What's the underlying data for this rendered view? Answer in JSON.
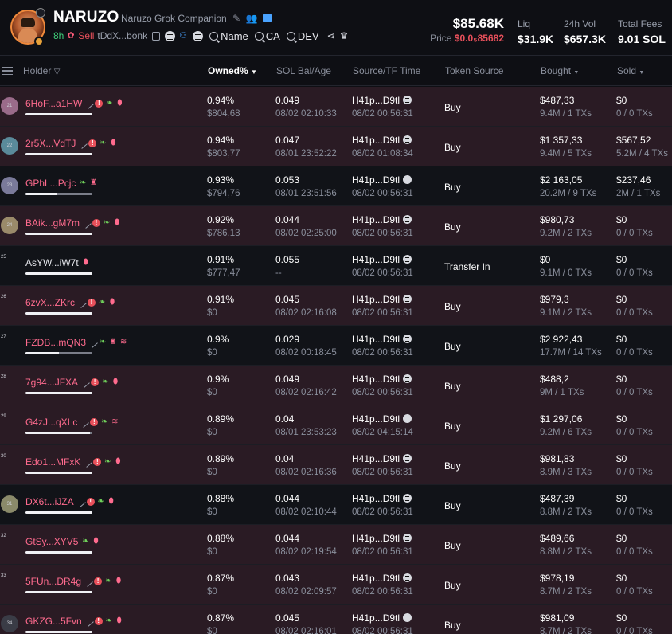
{
  "header": {
    "token_name": "NARUZO",
    "token_fullname": "Naruzo Grok Companion",
    "age": "8h",
    "sell_label": "Sell",
    "address": "tDdX...bonk",
    "search_name": "Name",
    "search_ca": "CA",
    "search_dev": "DEV",
    "mcap": "$85.68K",
    "price_label": "Price",
    "price_value": "$0.0₅85682",
    "liq_label": "Liq",
    "liq_value": "$31.9K",
    "vol_label": "24h Vol",
    "vol_value": "$657.3K",
    "fees_label": "Total Fees",
    "fees_value": "9.01 SOL"
  },
  "columns": {
    "holder": "Holder",
    "owned": "Owned%",
    "sol_bal": "SOL Bal/Age",
    "source": "Source/TF Time",
    "token_source": "Token Source",
    "bought": "Bought",
    "sold": "Sold"
  },
  "rows": [
    {
      "rank": "21",
      "addr": "6HoF...a1HW",
      "owned": "0.94%",
      "owned_usd": "$804,68",
      "sol": "0.049",
      "age": "08/02 02:10:33",
      "src": "H41p...D9tl",
      "tf": "08/02 00:56:31",
      "tsrc": "Buy",
      "bought": "$487,33",
      "bought_sub": "9.4M / 1 TXs",
      "sold": "$0",
      "sold_sub": "0 / 0 TXs",
      "bar": 1.0
    },
    {
      "rank": "22",
      "addr": "2r5X...VdTJ",
      "owned": "0.94%",
      "owned_usd": "$803,77",
      "sol": "0.047",
      "age": "08/01 23:52:22",
      "src": "H41p...D9tl",
      "tf": "08/02 01:08:34",
      "tsrc": "Buy",
      "bought": "$1 357,33",
      "bought_sub": "9.4M / 5 TXs",
      "sold": "$567,52",
      "sold_sub": "5.2M / 4 TXs",
      "bar": 1.0
    },
    {
      "rank": "23",
      "addr": "GPhL...Pcjc",
      "owned": "0.93%",
      "owned_usd": "$794,76",
      "sol": "0.053",
      "age": "08/01 23:51:56",
      "src": "H41p...D9tl",
      "tf": "08/02 00:56:31",
      "tsrc": "Buy",
      "bought": "$2 163,05",
      "bought_sub": "20.2M / 9 TXs",
      "sold": "$237,46",
      "sold_sub": "2M / 1 TXs",
      "bar": 0.46
    },
    {
      "rank": "24",
      "addr": "BAik...gM7m",
      "owned": "0.92%",
      "owned_usd": "$786,13",
      "sol": "0.044",
      "age": "08/02 02:25:00",
      "src": "H41p...D9tl",
      "tf": "08/02 00:56:31",
      "tsrc": "Buy",
      "bought": "$980,73",
      "bought_sub": "9.2M / 2 TXs",
      "sold": "$0",
      "sold_sub": "0 / 0 TXs",
      "bar": 1.0
    },
    {
      "rank": "25",
      "addr": "AsYW...iW7t",
      "owned": "0.91%",
      "owned_usd": "$777,47",
      "sol": "0.055",
      "age": "--",
      "src": "H41p...D9tl",
      "tf": "08/02 00:56:31",
      "tsrc": "Transfer In",
      "bought": "$0",
      "bought_sub": "9.1M / 0 TXs",
      "sold": "$0",
      "sold_sub": "0 / 0 TXs",
      "bar": 1.0
    },
    {
      "rank": "26",
      "addr": "6zvX...ZKrc",
      "owned": "0.91%",
      "owned_usd": "$0",
      "sol": "0.045",
      "age": "08/02 02:16:08",
      "src": "H41p...D9tl",
      "tf": "08/02 00:56:31",
      "tsrc": "Buy",
      "bought": "$979,3",
      "bought_sub": "9.1M / 2 TXs",
      "sold": "$0",
      "sold_sub": "0 / 0 TXs",
      "bar": 1.0
    },
    {
      "rank": "27",
      "addr": "FZDB...mQN3",
      "owned": "0.9%",
      "owned_usd": "$0",
      "sol": "0.029",
      "age": "08/02 00:18:45",
      "src": "H41p...D9tl",
      "tf": "08/02 00:56:31",
      "tsrc": "Buy",
      "bought": "$2 922,43",
      "bought_sub": "17.7M / 14 TXs",
      "sold": "$0",
      "sold_sub": "0 / 0 TXs",
      "bar": 0.5
    },
    {
      "rank": "28",
      "addr": "7g94...JFXA",
      "owned": "0.9%",
      "owned_usd": "$0",
      "sol": "0.049",
      "age": "08/02 02:16:42",
      "src": "H41p...D9tl",
      "tf": "08/02 00:56:31",
      "tsrc": "Buy",
      "bought": "$488,2",
      "bought_sub": "9M / 1 TXs",
      "sold": "$0",
      "sold_sub": "0 / 0 TXs",
      "bar": 1.0
    },
    {
      "rank": "29",
      "addr": "G4zJ...qXLc",
      "owned": "0.89%",
      "owned_usd": "$0",
      "sol": "0.04",
      "age": "08/01 23:53:23",
      "src": "H41p...D9tl",
      "tf": "08/02 04:15:14",
      "tsrc": "Buy",
      "bought": "$1 297,06",
      "bought_sub": "9.2M / 6 TXs",
      "sold": "$0",
      "sold_sub": "0 / 0 TXs",
      "bar": 0.97
    },
    {
      "rank": "30",
      "addr": "Edo1...MFxK",
      "owned": "0.89%",
      "owned_usd": "$0",
      "sol": "0.04",
      "age": "08/02 02:16:36",
      "src": "H41p...D9tl",
      "tf": "08/02 00:56:31",
      "tsrc": "Buy",
      "bought": "$981,83",
      "bought_sub": "8.9M / 3 TXs",
      "sold": "$0",
      "sold_sub": "0 / 0 TXs",
      "bar": 1.0
    },
    {
      "rank": "31",
      "addr": "DX6t...iJZA",
      "owned": "0.88%",
      "owned_usd": "$0",
      "sol": "0.044",
      "age": "08/02 02:10:44",
      "src": "H41p...D9tl",
      "tf": "08/02 00:56:31",
      "tsrc": "Buy",
      "bought": "$487,39",
      "bought_sub": "8.8M / 2 TXs",
      "sold": "$0",
      "sold_sub": "0 / 0 TXs",
      "bar": 1.0
    },
    {
      "rank": "32",
      "addr": "GtSy...XYV5",
      "owned": "0.88%",
      "owned_usd": "$0",
      "sol": "0.044",
      "age": "08/02 02:19:54",
      "src": "H41p...D9tl",
      "tf": "08/02 00:56:31",
      "tsrc": "Buy",
      "bought": "$489,66",
      "bought_sub": "8.8M / 2 TXs",
      "sold": "$0",
      "sold_sub": "0 / 0 TXs",
      "bar": 1.0
    },
    {
      "rank": "33",
      "addr": "5FUn...DR4g",
      "owned": "0.87%",
      "owned_usd": "$0",
      "sol": "0.043",
      "age": "08/02 02:09:57",
      "src": "H41p...D9tl",
      "tf": "08/02 00:56:31",
      "tsrc": "Buy",
      "bought": "$978,19",
      "bought_sub": "8.7M / 2 TXs",
      "sold": "$0",
      "sold_sub": "0 / 0 TXs",
      "bar": 1.0
    },
    {
      "rank": "34",
      "addr": "GKZG...5Fvn",
      "owned": "0.87%",
      "owned_usd": "$0",
      "sol": "0.045",
      "age": "08/02 02:16:01",
      "src": "H41p...D9tl",
      "tf": "08/02 00:56:31",
      "tsrc": "Buy",
      "bought": "$981,09",
      "bought_sub": "8.7M / 2 TXs",
      "sold": "$0",
      "sold_sub": "0 / 0 TXs",
      "bar": 1.0
    }
  ]
}
